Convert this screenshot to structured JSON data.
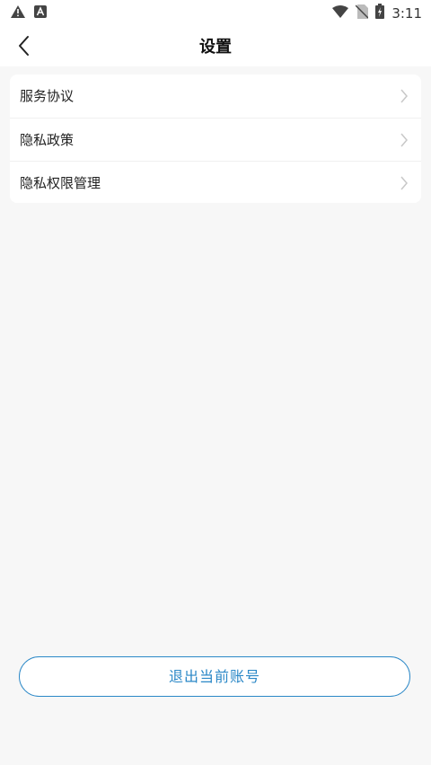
{
  "status_bar": {
    "time": "3:11",
    "left_icons": [
      "warning-icon",
      "a-app-icon"
    ],
    "right_icons": [
      "wifi-icon",
      "no-sim-icon",
      "battery-charging-icon"
    ]
  },
  "header": {
    "title": "设置",
    "back_icon": "chevron-left-icon"
  },
  "settings": {
    "items": [
      {
        "label": "服务协议",
        "icon": "chevron-right-icon"
      },
      {
        "label": "隐私政策",
        "icon": "chevron-right-icon"
      },
      {
        "label": "隐私权限管理",
        "icon": "chevron-right-icon"
      }
    ]
  },
  "logout": {
    "label": "退出当前账号",
    "color": "#2b88c7"
  }
}
